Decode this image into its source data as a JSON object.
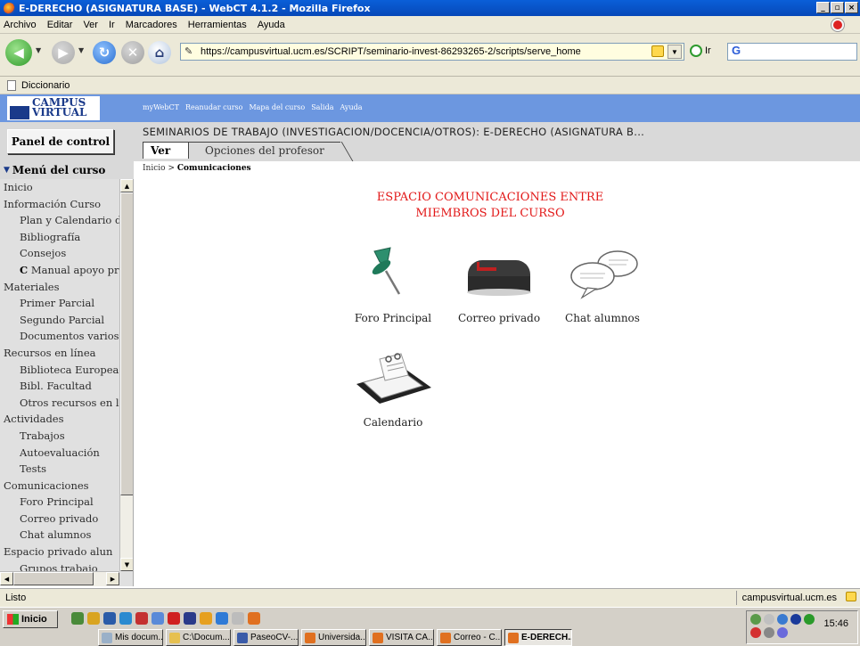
{
  "window": {
    "title": "E-DERECHO (ASIGNATURA BASE) - WebCT 4.1.2 - Mozilla Firefox",
    "controls": [
      "_",
      "̅",
      "X"
    ]
  },
  "menubar": [
    "Archivo",
    "Editar",
    "Ver",
    "Ir",
    "Marcadores",
    "Herramientas",
    "Ayuda"
  ],
  "navbar": {
    "url": "https://campusvirtual.ucm.es/SCRIPT/seminario-invest-86293265-2/scripts/serve_home",
    "go_label": "Ir",
    "search_value": "G"
  },
  "bookmarks": [
    "Diccionario"
  ],
  "header": {
    "logo_line1": "CAMPUS",
    "logo_line2": "VIRTUAL",
    "topnav": [
      "myWebCT",
      "Reanudar curso",
      "Mapa del curso",
      "Salida",
      "Ayuda"
    ]
  },
  "course": {
    "panel_button": "Panel de control",
    "title": "SEMINARIOS DE TRABAJO (INVESTIGACION/DOCENCIA/OTROS): E-DERECHO (ASIGNATURA B...",
    "tabs": [
      "Ver",
      "Opciones del profesor"
    ],
    "breadcrumb_home": "Inicio",
    "breadcrumb_sep": ">",
    "breadcrumb_current": "Comunicaciones"
  },
  "sidebar": {
    "heading": "Menú del curso",
    "items": [
      {
        "label": "Inicio",
        "level": 0
      },
      {
        "label": "Información Curso",
        "level": 0
      },
      {
        "label": "Plan y Calendario d",
        "level": 1
      },
      {
        "label": "Bibliografía",
        "level": 1
      },
      {
        "label": "Consejos",
        "level": 1
      },
      {
        "label": "Manual apoyo pr",
        "level": 1,
        "flag": "C"
      },
      {
        "label": "Materiales",
        "level": 0
      },
      {
        "label": "Primer Parcial",
        "level": 1
      },
      {
        "label": "Segundo Parcial",
        "level": 1
      },
      {
        "label": "Documentos varios",
        "level": 1
      },
      {
        "label": "Recursos en línea",
        "level": 0
      },
      {
        "label": "Biblioteca Europea",
        "level": 1
      },
      {
        "label": "Bibl. Facultad",
        "level": 1
      },
      {
        "label": "Otros recursos en la",
        "level": 1
      },
      {
        "label": "Actividades",
        "level": 0
      },
      {
        "label": "Trabajos",
        "level": 1
      },
      {
        "label": "Autoevaluación",
        "level": 1
      },
      {
        "label": "Tests",
        "level": 1
      },
      {
        "label": "Comunicaciones",
        "level": 0
      },
      {
        "label": "Foro Principal",
        "level": 1
      },
      {
        "label": "Correo privado",
        "level": 1
      },
      {
        "label": "Chat alumnos",
        "level": 1
      },
      {
        "label": "Espacio privado alun",
        "level": 0
      },
      {
        "label": "Grupos trabajo",
        "level": 1
      }
    ]
  },
  "main": {
    "heading_line1": "ESPACIO COMUNICACIONES ENTRE",
    "heading_line2": "MIEMBROS DEL CURSO",
    "tools": [
      {
        "label": "Foro Principal",
        "icon": "pushpin-icon"
      },
      {
        "label": "Correo privado",
        "icon": "mailbox-icon"
      },
      {
        "label": "Chat alumnos",
        "icon": "speech-bubbles-icon"
      },
      {
        "label": "Calendario",
        "icon": "desk-calendar-icon"
      }
    ]
  },
  "statusbar": {
    "text": "Listo",
    "host": "campusvirtual.ucm.es"
  },
  "taskbar": {
    "start_label": "Inicio",
    "tasks": [
      "Mis docum...",
      "C:\\Docum...",
      "PaseoCV-...",
      "Universida...",
      "VISITA CA...",
      "Correo - C...",
      "E-DERECH..."
    ],
    "clock": "15:46"
  },
  "colors": {
    "webct_blue": "#6c97e0",
    "heading_red": "#e21818",
    "titlebar_blue": "#0a5fd8"
  }
}
